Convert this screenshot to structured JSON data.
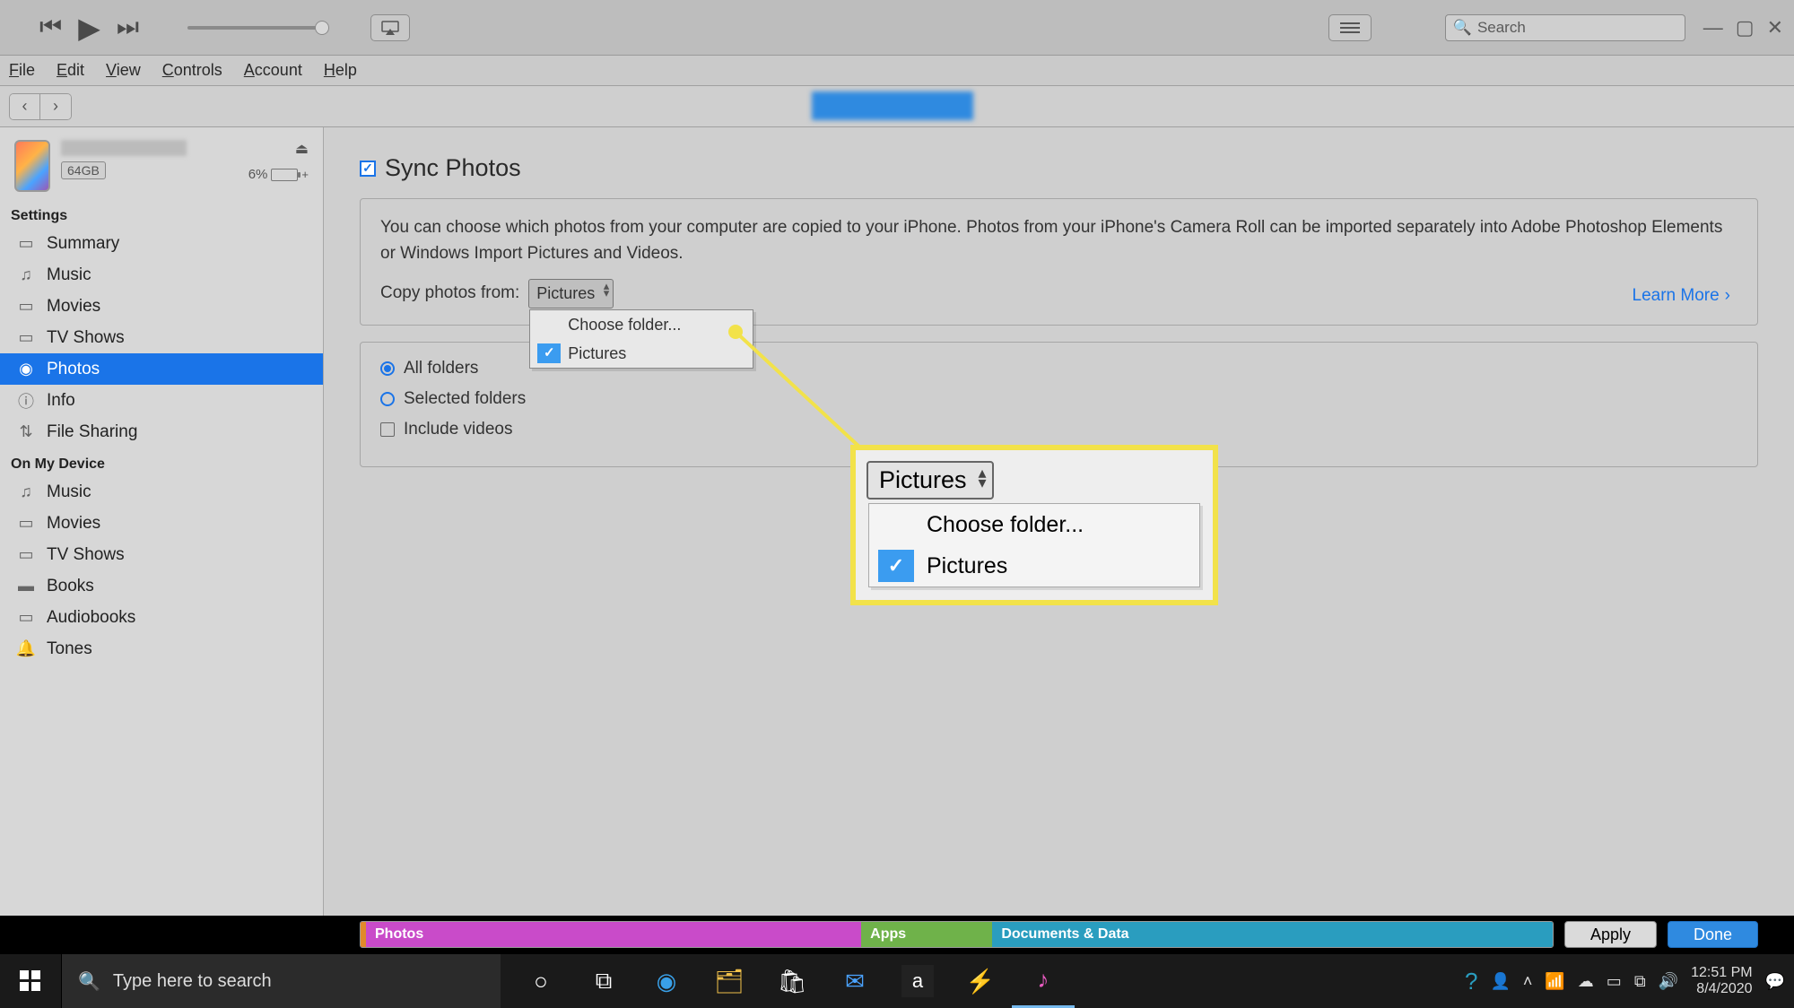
{
  "menubar": {
    "file": "File",
    "edit": "Edit",
    "view": "View",
    "controls": "Controls",
    "account": "Account",
    "help": "Help"
  },
  "search": {
    "placeholder": "Search"
  },
  "device": {
    "capacity": "64GB",
    "battery_pct": "6%"
  },
  "sidebar": {
    "settings_header": "Settings",
    "settings": [
      {
        "icon": "summary-icon",
        "label": "Summary"
      },
      {
        "icon": "music-icon",
        "label": "Music"
      },
      {
        "icon": "movies-icon",
        "label": "Movies"
      },
      {
        "icon": "tv-icon",
        "label": "TV Shows"
      },
      {
        "icon": "photos-icon",
        "label": "Photos",
        "selected": true
      },
      {
        "icon": "info-icon",
        "label": "Info"
      },
      {
        "icon": "filesharing-icon",
        "label": "File Sharing"
      }
    ],
    "device_header": "On My Device",
    "device_items": [
      {
        "icon": "music-icon",
        "label": "Music"
      },
      {
        "icon": "movies-icon",
        "label": "Movies"
      },
      {
        "icon": "tv-icon",
        "label": "TV Shows"
      },
      {
        "icon": "books-icon",
        "label": "Books"
      },
      {
        "icon": "audiobooks-icon",
        "label": "Audiobooks"
      },
      {
        "icon": "tones-icon",
        "label": "Tones"
      }
    ]
  },
  "main": {
    "title": "Sync Photos",
    "desc": "You can choose which photos from your computer are copied to your iPhone. Photos from your iPhone's Camera Roll can be imported separately into Adobe Photoshop Elements or Windows Import Pictures and Videos.",
    "copy_label": "Copy photos from:",
    "dropdown_value": "Pictures",
    "dropdown_items": {
      "choose": "Choose folder...",
      "pictures": "Pictures"
    },
    "learn_more": "Learn More",
    "all_folders": "All folders",
    "selected_folders": "Selected folders",
    "include_videos": "Include videos"
  },
  "callout": {
    "value": "Pictures",
    "choose": "Choose folder...",
    "pictures": "Pictures"
  },
  "storage": {
    "segments": [
      {
        "label": "Photos",
        "color": "#c94bc9",
        "width": "42%"
      },
      {
        "label": "Apps",
        "color": "#6fb24a",
        "width": "10%"
      },
      {
        "label": "Documents & Data",
        "color": "#2a9dbf",
        "width": "48%"
      }
    ]
  },
  "buttons": {
    "apply": "Apply",
    "done": "Done"
  },
  "taskbar": {
    "search_placeholder": "Type here to search",
    "time": "12:51 PM",
    "date": "8/4/2020"
  }
}
